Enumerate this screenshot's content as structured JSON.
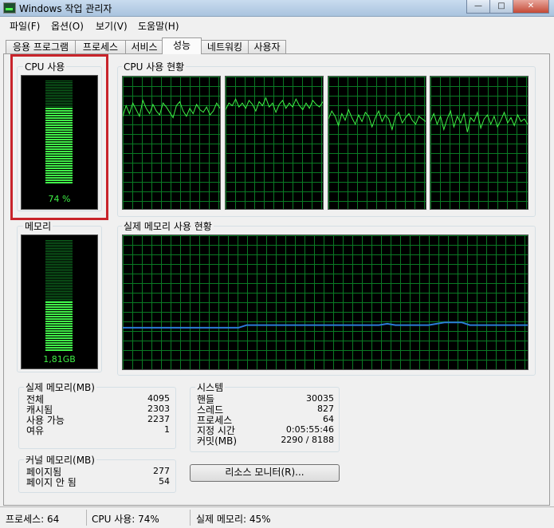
{
  "window": {
    "title": "Windows 작업 관리자",
    "buttons": {
      "minimize": "—",
      "maximize": "□",
      "close": "✕"
    }
  },
  "menu": [
    "파일(F)",
    "옵션(O)",
    "보기(V)",
    "도움말(H)"
  ],
  "tabs": [
    "응용 프로그램",
    "프로세스",
    "서비스",
    "성능",
    "네트워킹",
    "사용자"
  ],
  "active_tab": "성능",
  "cpu_usage": {
    "label": "CPU 사용",
    "value_text": "74 %",
    "fraction": 0.74
  },
  "cpu_history": {
    "label": "CPU 사용 현황",
    "cores": [
      [
        0.7,
        0.78,
        0.72,
        0.8,
        0.75,
        0.7,
        0.82,
        0.76,
        0.72,
        0.79,
        0.74,
        0.71,
        0.8,
        0.77,
        0.73,
        0.69,
        0.78,
        0.81,
        0.74,
        0.7,
        0.76,
        0.72,
        0.79,
        0.75,
        0.73,
        0.77,
        0.71,
        0.74,
        0.8,
        0.76
      ],
      [
        0.75,
        0.8,
        0.78,
        0.83,
        0.77,
        0.8,
        0.76,
        0.82,
        0.79,
        0.74,
        0.81,
        0.78,
        0.84,
        0.77,
        0.8,
        0.73,
        0.79,
        0.82,
        0.76,
        0.8,
        0.77,
        0.83,
        0.78,
        0.75,
        0.8,
        0.76,
        0.82,
        0.79,
        0.77,
        0.81
      ],
      [
        0.68,
        0.74,
        0.7,
        0.63,
        0.72,
        0.67,
        0.75,
        0.69,
        0.64,
        0.71,
        0.66,
        0.73,
        0.7,
        0.62,
        0.69,
        0.74,
        0.66,
        0.71,
        0.68,
        0.6,
        0.7,
        0.73,
        0.65,
        0.69,
        0.72,
        0.67,
        0.64,
        0.7,
        0.68,
        0.66
      ],
      [
        0.66,
        0.72,
        0.64,
        0.7,
        0.6,
        0.68,
        0.74,
        0.62,
        0.7,
        0.65,
        0.72,
        0.58,
        0.69,
        0.66,
        0.73,
        0.61,
        0.68,
        0.71,
        0.64,
        0.7,
        0.62,
        0.67,
        0.73,
        0.65,
        0.69,
        0.63,
        0.71,
        0.66,
        0.68,
        0.64
      ]
    ]
  },
  "memory": {
    "label": "메모리",
    "value_text": "1,81GB",
    "fraction": 0.45
  },
  "memory_history": {
    "label": "실제 메모리 사용 현황",
    "points": [
      0.31,
      0.31,
      0.31,
      0.31,
      0.31,
      0.31,
      0.31,
      0.31,
      0.31,
      0.31,
      0.31,
      0.31,
      0.31,
      0.31,
      0.31,
      0.33,
      0.33,
      0.33,
      0.33,
      0.33,
      0.33,
      0.33,
      0.33,
      0.33,
      0.33,
      0.33,
      0.33,
      0.33,
      0.33,
      0.33,
      0.33,
      0.33,
      0.34,
      0.33,
      0.33,
      0.33,
      0.33,
      0.33,
      0.34,
      0.35,
      0.35,
      0.35,
      0.33,
      0.33,
      0.33,
      0.33,
      0.33,
      0.33,
      0.33,
      0.33
    ]
  },
  "physical_memory": {
    "title": "실제 메모리(MB)",
    "rows": [
      {
        "label": "전체",
        "value": "4095"
      },
      {
        "label": "캐시됨",
        "value": "2303"
      },
      {
        "label": "사용 가능",
        "value": "2237"
      },
      {
        "label": "여유",
        "value": "1"
      }
    ]
  },
  "kernel_memory": {
    "title": "커널 메모리(MB)",
    "rows": [
      {
        "label": "페이지됨",
        "value": "277"
      },
      {
        "label": "페이지 안 됨",
        "value": "54"
      }
    ]
  },
  "system": {
    "title": "시스템",
    "rows": [
      {
        "label": "핸들",
        "value": "30035"
      },
      {
        "label": "스레드",
        "value": "827"
      },
      {
        "label": "프로세스",
        "value": "64"
      },
      {
        "label": "지정 시간",
        "value": "0:05:55:46"
      },
      {
        "label": "커밋(MB)",
        "value": "2290 / 8188"
      }
    ]
  },
  "resource_monitor_button": "리소스 모니터(R)...",
  "status": {
    "processes": "프로세스: 64",
    "cpu": "CPU 사용: 74%",
    "memory": "실제 메모리: 45%"
  },
  "colors": {
    "graph_line": "#3ff046",
    "memory_line": "#2b7bd8",
    "highlight": "#c8242b"
  }
}
